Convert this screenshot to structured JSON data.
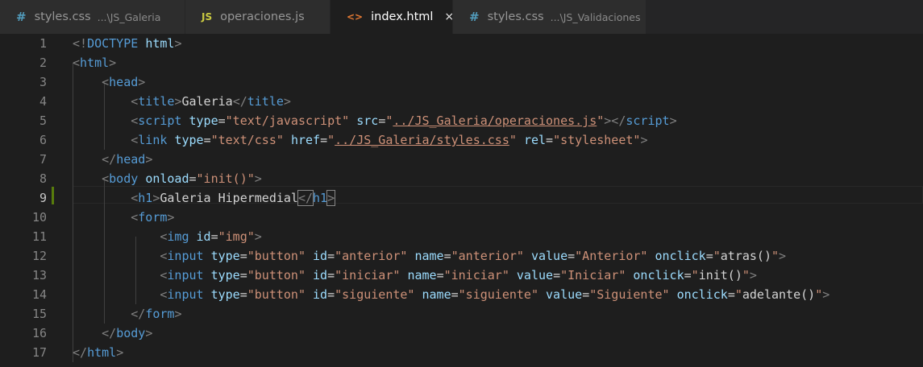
{
  "tabs": [
    {
      "icon": "#",
      "icon_name": "css-file-icon",
      "label": "styles.css",
      "desc": "...\\JS_Galeria",
      "active": false
    },
    {
      "icon": "JS",
      "icon_name": "js-file-icon",
      "label": "operaciones.js",
      "desc": "",
      "active": false
    },
    {
      "icon": "<>",
      "icon_name": "html-file-icon",
      "label": "index.html",
      "desc": "",
      "active": true,
      "close": "×"
    },
    {
      "icon": "#",
      "icon_name": "css-file-icon",
      "label": "styles.css",
      "desc": "...\\JS_Validaciones",
      "active": false
    }
  ],
  "editor": {
    "current_line": 9,
    "lines": [
      {
        "n": "1",
        "tokens": [
          [
            "t",
            "<!"
          ],
          [
            "n",
            "DOCTYPE"
          ],
          [
            "x",
            " "
          ],
          [
            "a",
            "html"
          ],
          [
            "t",
            ">"
          ]
        ]
      },
      {
        "n": "2",
        "tokens": [
          [
            "t",
            "<"
          ],
          [
            "n",
            "html"
          ],
          [
            "t",
            ">"
          ]
        ]
      },
      {
        "n": "3",
        "tokens": [
          [
            "x",
            "    "
          ],
          [
            "t",
            "<"
          ],
          [
            "n",
            "head"
          ],
          [
            "t",
            ">"
          ]
        ]
      },
      {
        "n": "4",
        "tokens": [
          [
            "x",
            "        "
          ],
          [
            "t",
            "<"
          ],
          [
            "n",
            "title"
          ],
          [
            "t",
            ">"
          ],
          [
            "x",
            "Galeria"
          ],
          [
            "t",
            "</"
          ],
          [
            "n",
            "title"
          ],
          [
            "t",
            ">"
          ]
        ]
      },
      {
        "n": "5",
        "tokens": [
          [
            "x",
            "        "
          ],
          [
            "t",
            "<"
          ],
          [
            "n",
            "script"
          ],
          [
            "x",
            " "
          ],
          [
            "a",
            "type"
          ],
          [
            "x",
            "="
          ],
          [
            "s",
            "\"text/javascript\""
          ],
          [
            "x",
            " "
          ],
          [
            "a",
            "src"
          ],
          [
            "x",
            "="
          ],
          [
            "s",
            "\""
          ],
          [
            "su",
            "../JS_Galeria/operaciones.js"
          ],
          [
            "s",
            "\""
          ],
          [
            "t",
            "></"
          ],
          [
            "n",
            "script"
          ],
          [
            "t",
            ">"
          ]
        ]
      },
      {
        "n": "6",
        "tokens": [
          [
            "x",
            "        "
          ],
          [
            "t",
            "<"
          ],
          [
            "n",
            "link"
          ],
          [
            "x",
            " "
          ],
          [
            "a",
            "type"
          ],
          [
            "x",
            "="
          ],
          [
            "s",
            "\"text/css\""
          ],
          [
            "x",
            " "
          ],
          [
            "a",
            "href"
          ],
          [
            "x",
            "="
          ],
          [
            "s",
            "\""
          ],
          [
            "su",
            "../JS_Galeria/styles.css"
          ],
          [
            "s",
            "\""
          ],
          [
            "x",
            " "
          ],
          [
            "a",
            "rel"
          ],
          [
            "x",
            "="
          ],
          [
            "s",
            "\"stylesheet\""
          ],
          [
            "t",
            ">"
          ]
        ]
      },
      {
        "n": "7",
        "tokens": [
          [
            "x",
            "    "
          ],
          [
            "t",
            "</"
          ],
          [
            "n",
            "head"
          ],
          [
            "t",
            ">"
          ]
        ]
      },
      {
        "n": "8",
        "tokens": [
          [
            "x",
            "    "
          ],
          [
            "t",
            "<"
          ],
          [
            "n",
            "body"
          ],
          [
            "x",
            " "
          ],
          [
            "a",
            "onload"
          ],
          [
            "x",
            "="
          ],
          [
            "s",
            "\"init()\""
          ],
          [
            "t",
            ">"
          ]
        ]
      },
      {
        "n": "9",
        "tokens": [
          [
            "x",
            "        "
          ],
          [
            "t",
            "<"
          ],
          [
            "n",
            "h1"
          ],
          [
            "t",
            ">"
          ],
          [
            "x",
            "Galeria Hipermedial"
          ],
          [
            "tb",
            "</"
          ],
          [
            "n",
            "h1"
          ],
          [
            "tb",
            ">"
          ]
        ]
      },
      {
        "n": "10",
        "tokens": [
          [
            "x",
            "        "
          ],
          [
            "t",
            "<"
          ],
          [
            "n",
            "form"
          ],
          [
            "t",
            ">"
          ]
        ]
      },
      {
        "n": "11",
        "tokens": [
          [
            "x",
            "            "
          ],
          [
            "t",
            "<"
          ],
          [
            "n",
            "img"
          ],
          [
            "x",
            " "
          ],
          [
            "a",
            "id"
          ],
          [
            "x",
            "="
          ],
          [
            "s",
            "\"img\""
          ],
          [
            "t",
            ">"
          ]
        ]
      },
      {
        "n": "12",
        "tokens": [
          [
            "x",
            "            "
          ],
          [
            "t",
            "<"
          ],
          [
            "n",
            "input"
          ],
          [
            "x",
            " "
          ],
          [
            "a",
            "type"
          ],
          [
            "x",
            "="
          ],
          [
            "s",
            "\"button\""
          ],
          [
            "x",
            " "
          ],
          [
            "a",
            "id"
          ],
          [
            "x",
            "="
          ],
          [
            "s",
            "\"anterior\""
          ],
          [
            "x",
            " "
          ],
          [
            "a",
            "name"
          ],
          [
            "x",
            "="
          ],
          [
            "s",
            "\"anterior\""
          ],
          [
            "x",
            " "
          ],
          [
            "a",
            "value"
          ],
          [
            "x",
            "="
          ],
          [
            "s",
            "\"Anterior\""
          ],
          [
            "x",
            " "
          ],
          [
            "a",
            "onclick"
          ],
          [
            "x",
            "="
          ],
          [
            "s",
            "\""
          ],
          [
            "x",
            "atras()"
          ],
          [
            "s",
            "\""
          ],
          [
            "t",
            ">"
          ]
        ]
      },
      {
        "n": "13",
        "tokens": [
          [
            "x",
            "            "
          ],
          [
            "t",
            "<"
          ],
          [
            "n",
            "input"
          ],
          [
            "x",
            " "
          ],
          [
            "a",
            "type"
          ],
          [
            "x",
            "="
          ],
          [
            "s",
            "\"button\""
          ],
          [
            "x",
            " "
          ],
          [
            "a",
            "id"
          ],
          [
            "x",
            "="
          ],
          [
            "s",
            "\"iniciar\""
          ],
          [
            "x",
            " "
          ],
          [
            "a",
            "name"
          ],
          [
            "x",
            "="
          ],
          [
            "s",
            "\"iniciar\""
          ],
          [
            "x",
            " "
          ],
          [
            "a",
            "value"
          ],
          [
            "x",
            "="
          ],
          [
            "s",
            "\"Iniciar\""
          ],
          [
            "x",
            " "
          ],
          [
            "a",
            "onclick"
          ],
          [
            "x",
            "="
          ],
          [
            "s",
            "\""
          ],
          [
            "x",
            "init()"
          ],
          [
            "s",
            "\""
          ],
          [
            "t",
            ">"
          ]
        ]
      },
      {
        "n": "14",
        "tokens": [
          [
            "x",
            "            "
          ],
          [
            "t",
            "<"
          ],
          [
            "n",
            "input"
          ],
          [
            "x",
            " "
          ],
          [
            "a",
            "type"
          ],
          [
            "x",
            "="
          ],
          [
            "s",
            "\"button\""
          ],
          [
            "x",
            " "
          ],
          [
            "a",
            "id"
          ],
          [
            "x",
            "="
          ],
          [
            "s",
            "\"siguiente\""
          ],
          [
            "x",
            " "
          ],
          [
            "a",
            "name"
          ],
          [
            "x",
            "="
          ],
          [
            "s",
            "\"siguiente\""
          ],
          [
            "x",
            " "
          ],
          [
            "a",
            "value"
          ],
          [
            "x",
            "="
          ],
          [
            "s",
            "\"Siguiente\""
          ],
          [
            "x",
            " "
          ],
          [
            "a",
            "onclick"
          ],
          [
            "x",
            "="
          ],
          [
            "s",
            "\""
          ],
          [
            "x",
            "adelante()"
          ],
          [
            "s",
            "\""
          ],
          [
            "t",
            ">"
          ]
        ]
      },
      {
        "n": "15",
        "tokens": [
          [
            "x",
            "        "
          ],
          [
            "t",
            "</"
          ],
          [
            "n",
            "form"
          ],
          [
            "t",
            ">"
          ]
        ]
      },
      {
        "n": "16",
        "tokens": [
          [
            "x",
            "    "
          ],
          [
            "t",
            "</"
          ],
          [
            "n",
            "body"
          ],
          [
            "t",
            ">"
          ]
        ]
      },
      {
        "n": "17",
        "tokens": [
          [
            "t",
            "</"
          ],
          [
            "n",
            "html"
          ],
          [
            "t",
            ">"
          ]
        ]
      }
    ]
  }
}
